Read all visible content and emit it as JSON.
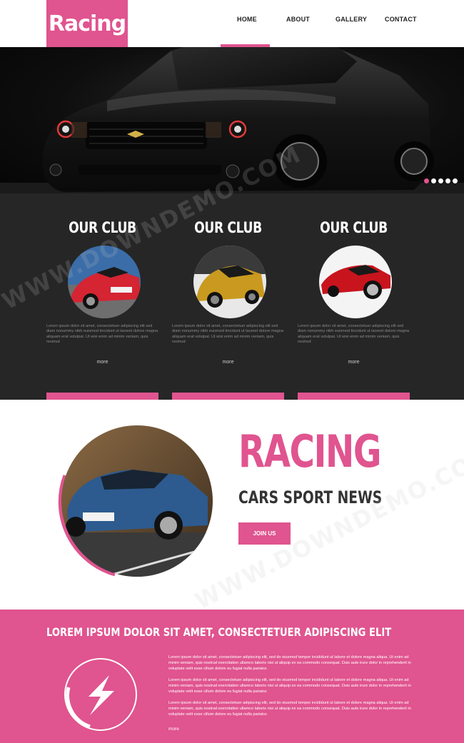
{
  "header": {
    "logo": "Racing",
    "nav": [
      "HOME",
      "ABOUT",
      "GALLERY",
      "CONTACT"
    ]
  },
  "hero": {
    "slides_count": 5,
    "active_slide": 1
  },
  "club": {
    "columns": [
      {
        "title": "OUR CLUB",
        "text": "Lorem ipsum dolor sit amet, consectetuer adipiscing elit sed diam nonummy nibh euismod tincidunt ut laoreet dolore magna aliquam erat volutpat. Ut wisi enim ad minim veniam, quis nostrud",
        "more": "more"
      },
      {
        "title": "OUR CLUB",
        "text": "Lorem ipsum dolor sit amet, consectetuer adipiscing elit sed diam nonummy nibh euismod tincidunt ut laoreet dolore magna aliquam erat volutpat. Ut wisi enim ad minim veniam, quis nostrud",
        "more": "more"
      },
      {
        "title": "OUR CLUB",
        "text": "Lorem ipsum dolor sit amet, consectetuer adipiscing elit sed diam nonummy nibh euismod tincidunt ut laoreet dolore magna aliquam erat volutpat. Ut wisi enim ad minim veniam, quis nostrud",
        "more": "more"
      }
    ]
  },
  "feature": {
    "title": "RACING",
    "subtitle": "CARS SPORT NEWS",
    "button": "JOIN US"
  },
  "pink": {
    "title": "LOREM IPSUM DOLOR SIT AMET, CONSECTETUER ADIPISCING ELIT",
    "paragraphs": [
      "Lorem ipsum dolor sit amet, consectetuer adipiscing elit, sed do eiusmod tempor incididunt ut labore et dolore magna aliqua. Ut enim ad minim veniam, quis nostrud exercitation ullamco laboris nisi ut aliquip ex ea commodo consequat. Duis aute irure dolor in reprehenderit in voluptate velit esse cillum dolore eu fugiat nulla pariatur.",
      "Lorem ipsum dolor sit amet, consectetuer adipiscing elit, sed do eiusmod tempor incididunt ut labore et dolore magna aliqua. Ut enim ad minim veniam, quis nostrud exercitation ullamco laboris nisi ut aliquip ex ea commodo consequat. Duis aute irure dolor in reprehenderit in voluptate velit esse cillum dolore eu fugiat nulla pariatur.",
      "Lorem ipsum dolor sit amet, consectetuer adipiscing elit, sed do eiusmod tempor incididunt ut labore et dolore magna aliqua. Ut enim ad minim veniam, quis nostrud exercitation ullamco laboris nisi ut aliquip ex ea commodo consequat. Duis aute irure dolor in reprehenderit in voluptate velit esse cillum dolore eu fugiat nulla pariatur."
    ],
    "more": "more"
  },
  "watermark": "WWW.DOWNDEMO.COM",
  "colors": {
    "accent": "#e0548f",
    "dark": "#262626"
  }
}
